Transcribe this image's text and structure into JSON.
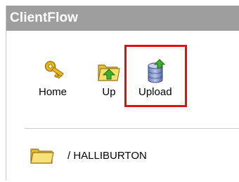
{
  "app": {
    "title": "ClientFlow"
  },
  "toolbar": {
    "home_label": "Home",
    "up_label": "Up",
    "upload_label": "Upload"
  },
  "folders": [
    {
      "name": "/ HALLIBURTON"
    }
  ],
  "colors": {
    "title_bar_bg": "#9e9e9e",
    "title_text": "#ffffff",
    "highlight_border": "#e01010",
    "folder_yellow": "#f2d65a"
  },
  "icons": {
    "home": "key-icon",
    "up": "folder-up-icon",
    "upload": "database-upload-icon",
    "folder": "folder-icon"
  }
}
